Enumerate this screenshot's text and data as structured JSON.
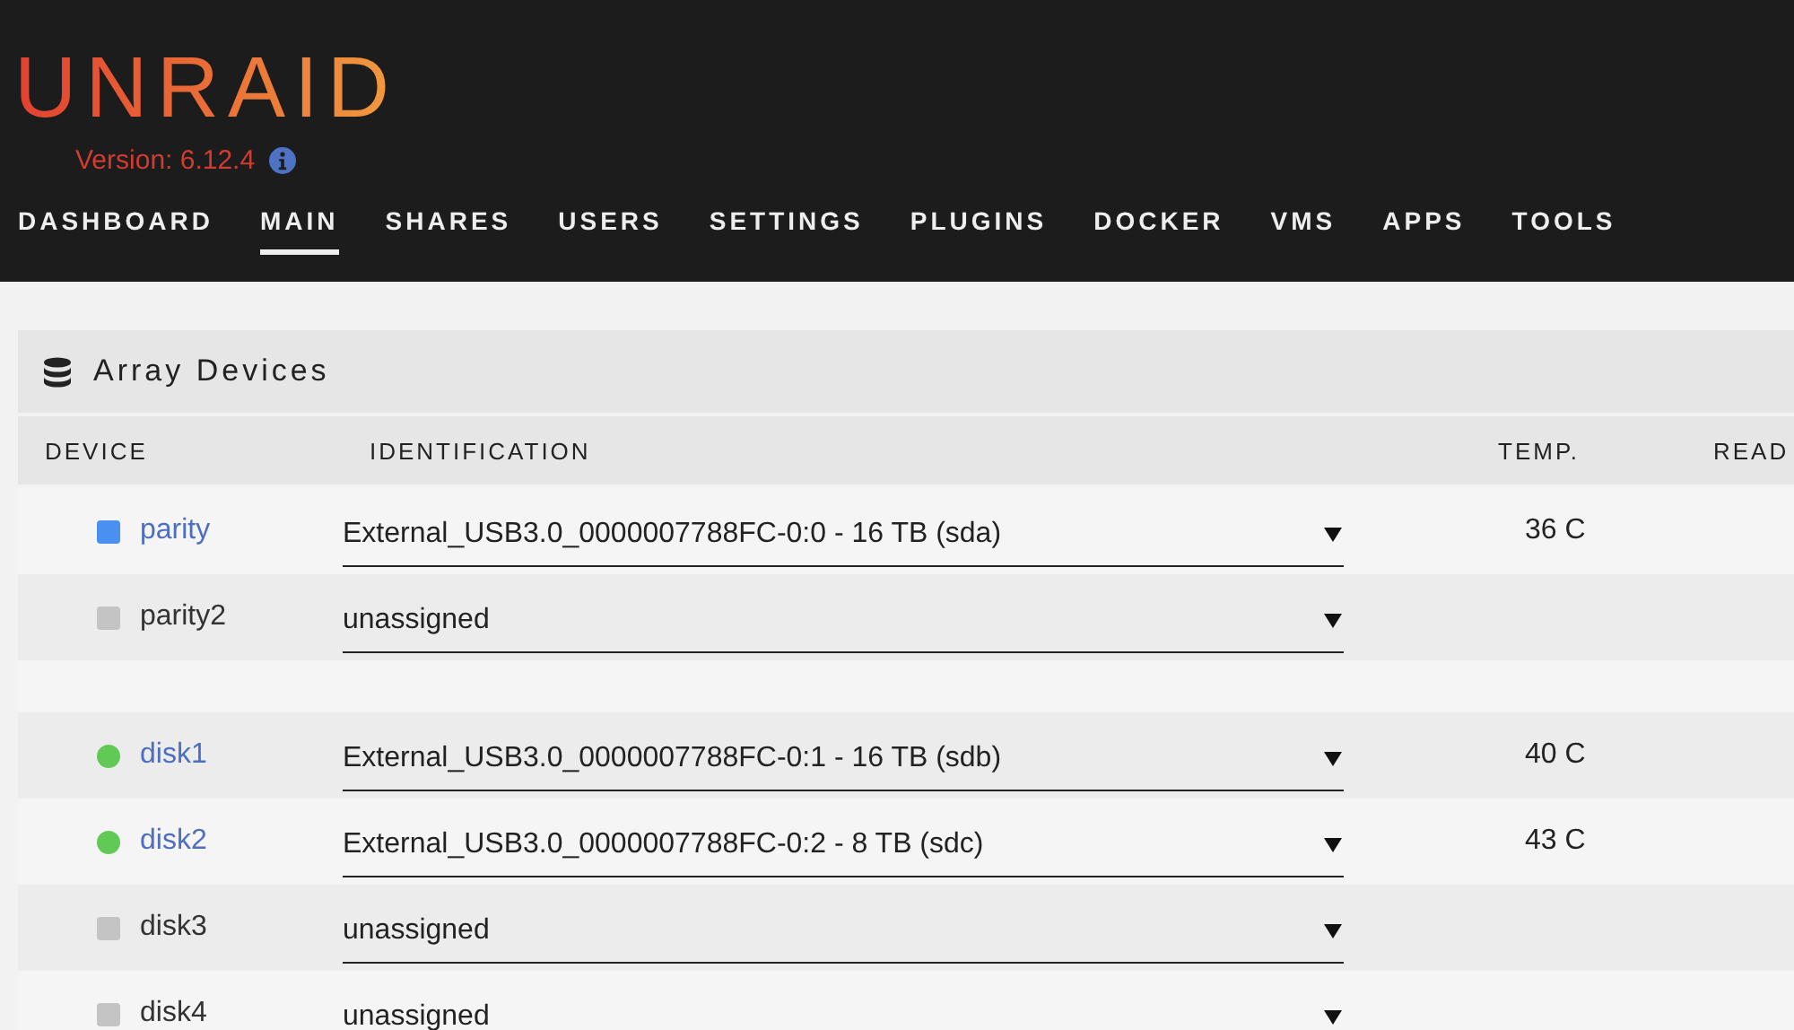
{
  "logo": "UNRAID",
  "version": "Version: 6.12.4",
  "nav": [
    {
      "label": "DASHBOARD",
      "selected": false
    },
    {
      "label": "MAIN",
      "selected": true
    },
    {
      "label": "SHARES",
      "selected": false
    },
    {
      "label": "USERS",
      "selected": false
    },
    {
      "label": "SETTINGS",
      "selected": false
    },
    {
      "label": "PLUGINS",
      "selected": false
    },
    {
      "label": "DOCKER",
      "selected": false
    },
    {
      "label": "VMS",
      "selected": false
    },
    {
      "label": "APPS",
      "selected": false
    },
    {
      "label": "TOOLS",
      "selected": false
    }
  ],
  "panel": {
    "title": "Array Devices",
    "columns": [
      "DEVICE",
      "IDENTIFICATION",
      "TEMP.",
      "READ"
    ],
    "rows": [
      {
        "kind": "device",
        "name": "parity",
        "link": true,
        "status": {
          "kind": "square",
          "color": "#4a90f0"
        },
        "identification": "External_USB3.0_0000007788FC-0:0 - 16 TB (sda)",
        "temp": "36 C"
      },
      {
        "kind": "device",
        "name": "parity2",
        "link": false,
        "status": {
          "kind": "square",
          "color": "#c4c4c4"
        },
        "identification": "unassigned"
      },
      {
        "kind": "spacer"
      },
      {
        "kind": "device",
        "name": "disk1",
        "link": true,
        "status": {
          "kind": "circle",
          "color": "#63c956"
        },
        "identification": "External_USB3.0_0000007788FC-0:1 - 16 TB (sdb)",
        "temp": "40 C"
      },
      {
        "kind": "device",
        "name": "disk2",
        "link": true,
        "status": {
          "kind": "circle",
          "color": "#63c956"
        },
        "identification": "External_USB3.0_0000007788FC-0:2 - 8 TB (sdc)",
        "temp": "43 C"
      },
      {
        "kind": "device",
        "name": "disk3",
        "link": false,
        "status": {
          "kind": "square",
          "color": "#c4c4c4"
        },
        "identification": "unassigned"
      },
      {
        "kind": "device",
        "name": "disk4",
        "link": false,
        "status": {
          "kind": "square",
          "color": "#c4c4c4"
        },
        "identification": "unassigned"
      }
    ]
  }
}
